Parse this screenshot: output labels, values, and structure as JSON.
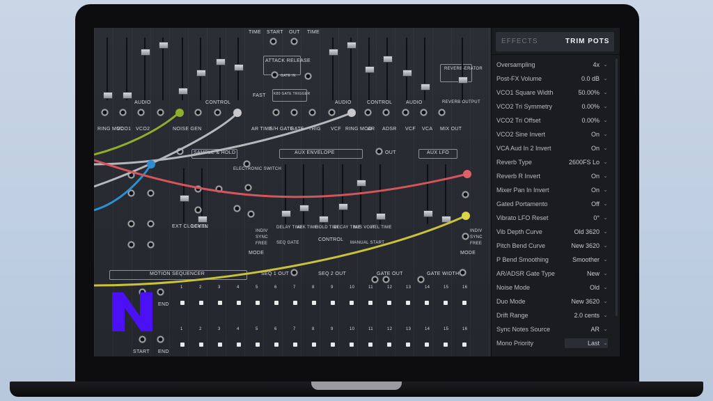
{
  "rack": {
    "labels": {
      "time1": "TIME",
      "start": "START",
      "out1": "OUT",
      "time2": "TIME",
      "attack_release": "ATTACK RELEASE",
      "gate_in": "GATE IN",
      "audio1": "AUDIO",
      "control1": "CONTROL",
      "audio2": "AUDIO",
      "control2": "CONTROL",
      "audio3": "AUDIO",
      "reverberator": "REVERB-ERATOR",
      "reverb_output": "REVERB OUTPUT",
      "k80_gate": "K80 GATE TRIGGER",
      "fast": "FAST",
      "ring_mod": "RING MOD",
      "vco1": "VCO1",
      "vco2": "VCO2",
      "noise_gen": "NOISE GEN",
      "ar_time": "AR TIME",
      "sh_gate": "S/H GATE",
      "gate": "GATE",
      "trig": "TRIG",
      "vcf": "VCF",
      "ring_mod2": "RING MOD",
      "ar": "AR",
      "adsr": "ADSR",
      "vca": "VCA",
      "mix_out": "MIX OUT",
      "sample_hold": "SAMPLE & HOLD",
      "aux_envelope": "AUX ENVELOPE",
      "out2": "OUT",
      "aux_lfo": "AUX LFO",
      "electronic_switch": "ELECTRONIC SWITCH",
      "ext_clock_in": "EXT CLOCK IN",
      "level": "LEVEL",
      "delay_time": "DELAY TIME",
      "atk_time": "ATK TIME",
      "hold_time": "HOLD TIME",
      "decay_time": "DECAY TIME",
      "sus_volt": "SUS VOLT",
      "rel_time": "REL TIME",
      "control3": "CONTROL",
      "seq_gate": "SEQ GATE",
      "manual_start": "MANUAL START",
      "indiv": "INDIV",
      "sync": "SYNC",
      "free": "FREE",
      "mode": "MODE",
      "motion_sequencer": "MOTION SEQUENCER",
      "seq1_out": "SEQ 1 OUT",
      "seq2_out": "SEQ 2 OUT",
      "gate_out": "GATE OUT",
      "gate_width": "GATE WIDTH",
      "end": "END",
      "start2": "START"
    },
    "seq_steps": [
      "1",
      "2",
      "3",
      "4",
      "5",
      "6",
      "7",
      "8",
      "9",
      "10",
      "11",
      "12",
      "13",
      "14",
      "15",
      "16"
    ],
    "cable_colors": {
      "olive": "#8fae2b",
      "blue": "#2d8fd0",
      "red": "#d6555c",
      "yellow": "#c9c23a",
      "grey": "#b8b8bc"
    },
    "logo_color": "#4b10f5"
  },
  "panel": {
    "tabs": [
      "EFFECTS",
      "TRIM POTS"
    ],
    "active_tab": "TRIM POTS",
    "params": [
      {
        "label": "Oversampling",
        "value": "4x"
      },
      {
        "label": "Post-FX Volume",
        "value": "0.0 dB"
      },
      {
        "label": "VCO1 Square Width",
        "value": "50.00%"
      },
      {
        "label": "VCO2 Tri Symmetry",
        "value": "0.00%"
      },
      {
        "label": "VCO2 Tri Offset",
        "value": "0.00%"
      },
      {
        "label": "VCO2 Sine Invert",
        "value": "On"
      },
      {
        "label": "VCA Aud In 2 Invert",
        "value": "On"
      },
      {
        "label": "Reverb Type",
        "value": "2600FS Lo"
      },
      {
        "label": "Reverb R Invert",
        "value": "On"
      },
      {
        "label": "Mixer Pan In Invert",
        "value": "On"
      },
      {
        "label": "Gated Portamento",
        "value": "Off"
      },
      {
        "label": "Vibrato LFO Reset",
        "value": "0°"
      },
      {
        "label": "Vib Depth Curve",
        "value": "Old 3620"
      },
      {
        "label": "Pitch Bend Curve",
        "value": "New 3620"
      },
      {
        "label": "P Bend Smoothing",
        "value": "Smoother"
      },
      {
        "label": "AR/ADSR Gate Type",
        "value": "New"
      },
      {
        "label": "Noise Mode",
        "value": "Old"
      },
      {
        "label": "Duo Mode",
        "value": "New 3620"
      },
      {
        "label": "Drift Range",
        "value": "2.0 cents"
      },
      {
        "label": "Sync Notes Source",
        "value": "AR"
      },
      {
        "label": "Mono Priority",
        "value": "Last"
      }
    ]
  }
}
